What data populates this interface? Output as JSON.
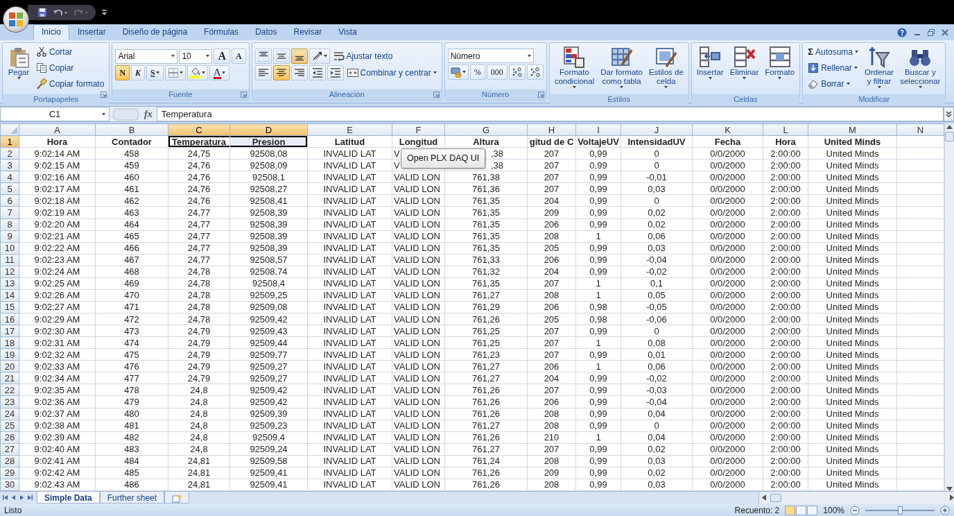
{
  "ribbon_tabs": [
    {
      "label": "Inicio",
      "selected": true
    },
    {
      "label": "Insertar",
      "selected": false
    },
    {
      "label": "Diseño de página",
      "selected": false
    },
    {
      "label": "Fórmulas",
      "selected": false
    },
    {
      "label": "Datos",
      "selected": false
    },
    {
      "label": "Revisar",
      "selected": false
    },
    {
      "label": "Vista",
      "selected": false
    }
  ],
  "groups": [
    {
      "title": "Portapapeles",
      "blocks": [
        {
          "kind": "large",
          "label": "Pegar",
          "dropdown": true
        },
        {
          "kind": "stack",
          "rows": [
            [
              {
                "kind": "small",
                "label": "Cortar"
              }
            ],
            [
              {
                "kind": "small",
                "label": "Copiar"
              }
            ],
            [
              {
                "kind": "small",
                "label": "Copiar formato"
              }
            ]
          ]
        }
      ]
    },
    {
      "title": "Fuente",
      "blocks": [
        {
          "kind": "stack",
          "rows": [
            [
              {
                "kind": "combo",
                "value": "Arial"
              },
              {
                "kind": "combo",
                "value": "10"
              },
              {
                "kind": "text",
                "label": "A"
              },
              {
                "kind": "text",
                "label": "A"
              }
            ],
            [
              {
                "kind": "text",
                "label": "N",
                "selected": true
              },
              {
                "kind": "text",
                "label": "K",
                "selected": false
              },
              {
                "kind": "text",
                "label": "S",
                "selected": false,
                "dropdown": true
              },
              {
                "kind": "icon",
                "dropdown": true
              },
              {
                "kind": "icon",
                "dropdown": true
              },
              {
                "kind": "text",
                "label": "A",
                "dropdown": true
              }
            ]
          ]
        }
      ]
    },
    {
      "title": "Alineación",
      "blocks": [
        {
          "kind": "stack",
          "rows": [
            [
              {
                "kind": "icon",
                "selected": false
              },
              {
                "kind": "icon",
                "selected": false
              },
              {
                "kind": "icon",
                "selected": true
              },
              {
                "kind": "icon",
                "dropdown": true
              },
              {
                "kind": "small",
                "label": "Ajustar texto"
              }
            ],
            [
              {
                "kind": "icon",
                "selected": false
              },
              {
                "kind": "icon",
                "selected": true
              },
              {
                "kind": "icon",
                "selected": false
              },
              {
                "kind": "icon"
              },
              {
                "kind": "icon"
              },
              {
                "kind": "small",
                "label": "Combinar y centrar",
                "dropdown": true
              }
            ]
          ]
        }
      ]
    },
    {
      "title": "Número",
      "blocks": [
        {
          "kind": "stack",
          "rows": [
            [
              {
                "kind": "combo",
                "value": "Número"
              }
            ],
            [
              {
                "kind": "icon",
                "dropdown": true
              },
              {
                "kind": "text",
                "label": "%"
              },
              {
                "kind": "text",
                "label": "000"
              },
              {
                "kind": "icon"
              },
              {
                "kind": "icon"
              }
            ]
          ]
        }
      ]
    },
    {
      "title": "Estilos",
      "blocks": [
        {
          "kind": "large",
          "label": "Formato\ncondicional",
          "dropdown": true
        },
        {
          "kind": "large",
          "label": "Dar formato\ncomo tabla",
          "dropdown": true
        },
        {
          "kind": "large",
          "label": "Estilos de\ncelda",
          "dropdown": true
        }
      ]
    },
    {
      "title": "Celdas",
      "blocks": [
        {
          "kind": "large",
          "label": "Insertar",
          "dropdown": true
        },
        {
          "kind": "large",
          "label": "Eliminar",
          "dropdown": true
        },
        {
          "kind": "large",
          "label": "Formato",
          "dropdown": true
        }
      ]
    },
    {
      "title": "Modificar",
      "blocks": [
        {
          "kind": "stack",
          "rows": [
            [
              {
                "kind": "small",
                "glyph": "Σ",
                "label": "Autosuma",
                "dropdown": true
              }
            ],
            [
              {
                "kind": "small",
                "label": "Rellenar",
                "dropdown": true
              }
            ],
            [
              {
                "kind": "small",
                "label": "Borrar",
                "dropdown": true
              }
            ]
          ]
        },
        {
          "kind": "large",
          "label": "Ordenar\ny filtrar",
          "dropdown": true
        },
        {
          "kind": "large",
          "label": "Buscar y\nseleccionar",
          "dropdown": true
        }
      ]
    }
  ],
  "formula_bar": {
    "name_box": "C1",
    "fx": "fx",
    "content": "Temperatura"
  },
  "columns": [
    {
      "label": "A",
      "selected": false
    },
    {
      "label": "B",
      "selected": false
    },
    {
      "label": "C",
      "selected": true
    },
    {
      "label": "D",
      "selected": true
    },
    {
      "label": "E",
      "selected": false
    },
    {
      "label": "F",
      "selected": false
    },
    {
      "label": "G",
      "selected": false
    },
    {
      "label": "H",
      "selected": false
    },
    {
      "label": "I",
      "selected": false
    },
    {
      "label": "J",
      "selected": false
    },
    {
      "label": "K",
      "selected": false
    },
    {
      "label": "L",
      "selected": false
    },
    {
      "label": "M",
      "selected": false
    },
    {
      "label": "N",
      "selected": false
    }
  ],
  "rows": [
    {
      "label": "1",
      "selected": true,
      "cells": [
        "Hora",
        "Contador",
        "Temperatura",
        "Presion",
        "Latitud",
        "Longitud",
        "Altura",
        "gitud de C",
        "VoltajeUV",
        "IntensidadUV",
        "Fecha",
        "Hora",
        "United Minds"
      ]
    },
    {
      "label": "2",
      "selected": false,
      "cells": [
        "9:02:14 AM",
        "458",
        "24,75",
        "92508,08",
        "INVALID LAT",
        "V",
        {
          "text": ",38",
          "partly_covered": true
        },
        "207",
        "0,99",
        "0",
        "0/0/2000",
        "2:00:00",
        "United Minds"
      ]
    },
    {
      "label": "3",
      "selected": false,
      "cells": [
        "9:02:15 AM",
        "459",
        "24,76",
        "92508,09",
        "INVALID LAT",
        "V",
        {
          "text": ",38",
          "partly_covered": true
        },
        "207",
        "0,99",
        "0",
        "0/0/2000",
        "2:00:00",
        "United Minds"
      ]
    },
    {
      "label": "4",
      "selected": false,
      "cells": [
        "9:02:16 AM",
        "460",
        "24,76",
        "92508,1",
        "INVALID LAT",
        "VALID LON",
        "761,38",
        "207",
        "0,99",
        "-0,01",
        "0/0/2000",
        "2:00:00",
        "United Minds"
      ]
    },
    {
      "label": "5",
      "selected": false,
      "cells": [
        "9:02:17 AM",
        "461",
        "24,76",
        "92508,27",
        "INVALID LAT",
        "VALID LON",
        "761,36",
        "207",
        "0,99",
        "0,03",
        "0/0/2000",
        "2:00:00",
        "United Minds"
      ]
    },
    {
      "label": "6",
      "selected": false,
      "cells": [
        "9:02:18 AM",
        "462",
        "24,76",
        "92508,41",
        "INVALID LAT",
        "VALID LON",
        "761,35",
        "204",
        "0,99",
        "0",
        "0/0/2000",
        "2:00:00",
        "United Minds"
      ]
    },
    {
      "label": "7",
      "selected": false,
      "cells": [
        "9:02:19 AM",
        "463",
        "24,77",
        "92508,39",
        "INVALID LAT",
        "VALID LON",
        "761,35",
        "209",
        "0,99",
        "0,02",
        "0/0/2000",
        "2:00:00",
        "United Minds"
      ]
    },
    {
      "label": "8",
      "selected": false,
      "cells": [
        "9:02:20 AM",
        "464",
        "24,77",
        "92508,39",
        "INVALID LAT",
        "VALID LON",
        "761,35",
        "206",
        "0,99",
        "0,02",
        "0/0/2000",
        "2:00:00",
        "United Minds"
      ]
    },
    {
      "label": "9",
      "selected": false,
      "cells": [
        "9:02:21 AM",
        "465",
        "24,77",
        "92508,39",
        "INVALID LAT",
        "VALID LON",
        "761,35",
        "208",
        "1",
        "0,06",
        "0/0/2000",
        "2:00:00",
        "United Minds"
      ]
    },
    {
      "label": "10",
      "selected": false,
      "cells": [
        "9:02:22 AM",
        "466",
        "24,77",
        "92508,39",
        "INVALID LAT",
        "VALID LON",
        "761,35",
        "205",
        "0,99",
        "0,03",
        "0/0/2000",
        "2:00:00",
        "United Minds"
      ]
    },
    {
      "label": "11",
      "selected": false,
      "cells": [
        "9:02:23 AM",
        "467",
        "24,77",
        "92508,57",
        "INVALID LAT",
        "VALID LON",
        "761,33",
        "206",
        "0,99",
        "-0,04",
        "0/0/2000",
        "2:00:00",
        "United Minds"
      ]
    },
    {
      "label": "12",
      "selected": false,
      "cells": [
        "9:02:24 AM",
        "468",
        "24,78",
        "92508,74",
        "INVALID LAT",
        "VALID LON",
        "761,32",
        "204",
        "0,99",
        "-0,02",
        "0/0/2000",
        "2:00:00",
        "United Minds"
      ]
    },
    {
      "label": "13",
      "selected": false,
      "cells": [
        "9:02:25 AM",
        "469",
        "24,78",
        "92508,4",
        "INVALID LAT",
        "VALID LON",
        "761,35",
        "207",
        "1",
        "0,1",
        "0/0/2000",
        "2:00:00",
        "United Minds"
      ]
    },
    {
      "label": "14",
      "selected": false,
      "cells": [
        "9:02:26 AM",
        "470",
        "24,78",
        "92509,25",
        "INVALID LAT",
        "VALID LON",
        "761,27",
        "208",
        "1",
        "0,05",
        "0/0/2000",
        "2:00:00",
        "United Minds"
      ]
    },
    {
      "label": "15",
      "selected": false,
      "cells": [
        "9:02:27 AM",
        "471",
        "24,78",
        "92509,08",
        "INVALID LAT",
        "VALID LON",
        "761,29",
        "206",
        "0,98",
        "-0,05",
        "0/0/2000",
        "2:00:00",
        "United Minds"
      ]
    },
    {
      "label": "16",
      "selected": false,
      "cells": [
        "9:02:29 AM",
        "472",
        "24,78",
        "92509,42",
        "INVALID LAT",
        "VALID LON",
        "761,26",
        "205",
        "0,98",
        "-0,06",
        "0/0/2000",
        "2:00:00",
        "United Minds"
      ]
    },
    {
      "label": "17",
      "selected": false,
      "cells": [
        "9:02:30 AM",
        "473",
        "24,79",
        "92509,43",
        "INVALID LAT",
        "VALID LON",
        "761,25",
        "207",
        "0,99",
        "0",
        "0/0/2000",
        "2:00:00",
        "United Minds"
      ]
    },
    {
      "label": "18",
      "selected": false,
      "cells": [
        "9:02:31 AM",
        "474",
        "24,79",
        "92509,44",
        "INVALID LAT",
        "VALID LON",
        "761,25",
        "207",
        "1",
        "0,08",
        "0/0/2000",
        "2:00:00",
        "United Minds"
      ]
    },
    {
      "label": "19",
      "selected": false,
      "cells": [
        "9:02:32 AM",
        "475",
        "24,79",
        "92509,77",
        "INVALID LAT",
        "VALID LON",
        "761,23",
        "207",
        "0,99",
        "0,01",
        "0/0/2000",
        "2:00:00",
        "United Minds"
      ]
    },
    {
      "label": "20",
      "selected": false,
      "cells": [
        "9:02:33 AM",
        "476",
        "24,79",
        "92509,27",
        "INVALID LAT",
        "VALID LON",
        "761,27",
        "206",
        "1",
        "0,06",
        "0/0/2000",
        "2:00:00",
        "United Minds"
      ]
    },
    {
      "label": "21",
      "selected": false,
      "cells": [
        "9:02:34 AM",
        "477",
        "24,79",
        "92509,27",
        "INVALID LAT",
        "VALID LON",
        "761,27",
        "204",
        "0,99",
        "-0,02",
        "0/0/2000",
        "2:00:00",
        "United Minds"
      ]
    },
    {
      "label": "22",
      "selected": false,
      "cells": [
        "9:02:35 AM",
        "478",
        "24,8",
        "92509,42",
        "INVALID LAT",
        "VALID LON",
        "761,26",
        "207",
        "0,99",
        "-0,03",
        "0/0/2000",
        "2:00:00",
        "United Minds"
      ]
    },
    {
      "label": "23",
      "selected": false,
      "cells": [
        "9:02:36 AM",
        "479",
        "24,8",
        "92509,42",
        "INVALID LAT",
        "VALID LON",
        "761,26",
        "206",
        "0,99",
        "-0,04",
        "0/0/2000",
        "2:00:00",
        "United Minds"
      ]
    },
    {
      "label": "24",
      "selected": false,
      "cells": [
        "9:02:37 AM",
        "480",
        "24,8",
        "92509,39",
        "INVALID LAT",
        "VALID LON",
        "761,26",
        "208",
        "0,99",
        "0,04",
        "0/0/2000",
        "2:00:00",
        "United Minds"
      ]
    },
    {
      "label": "25",
      "selected": false,
      "cells": [
        "9:02:38 AM",
        "481",
        "24,8",
        "92509,23",
        "INVALID LAT",
        "VALID LON",
        "761,27",
        "208",
        "0,99",
        "0",
        "0/0/2000",
        "2:00:00",
        "United Minds"
      ]
    },
    {
      "label": "26",
      "selected": false,
      "cells": [
        "9:02:39 AM",
        "482",
        "24,8",
        "92509,4",
        "INVALID LAT",
        "VALID LON",
        "761,26",
        "210",
        "1",
        "0,04",
        "0/0/2000",
        "2:00:00",
        "United Minds"
      ]
    },
    {
      "label": "27",
      "selected": false,
      "cells": [
        "9:02:40 AM",
        "483",
        "24,8",
        "92509,24",
        "INVALID LAT",
        "VALID LON",
        "761,27",
        "207",
        "0,99",
        "0,02",
        "0/0/2000",
        "2:00:00",
        "United Minds"
      ]
    },
    {
      "label": "28",
      "selected": false,
      "cells": [
        "9:02:41 AM",
        "484",
        "24,81",
        "92509,58",
        "INVALID LAT",
        "VALID LON",
        "761,24",
        "208",
        "0,99",
        "0,03",
        "0/0/2000",
        "2:00:00",
        "United Minds"
      ]
    },
    {
      "label": "29",
      "selected": false,
      "cells": [
        "9:02:42 AM",
        "485",
        "24,81",
        "92509,41",
        "INVALID LAT",
        "VALID LON",
        "761,26",
        "209",
        "0,99",
        "0,02",
        "0/0/2000",
        "2:00:00",
        "United Minds"
      ]
    },
    {
      "label": "30",
      "selected": false,
      "cells": [
        "9:02:43 AM",
        "486",
        "24,81",
        "92509,41",
        "INVALID LAT",
        "VALID LON",
        "761,26",
        "208",
        "0,99",
        "0,03",
        "0/0/2000",
        "2:00:00",
        "United Minds"
      ]
    }
  ],
  "floating_button": {
    "label": "Open PLX DAQ UI"
  },
  "sheet_tabs": [
    {
      "label": "Simple Data",
      "selected": true
    },
    {
      "label": "Further sheet",
      "selected": false
    }
  ],
  "status_bar": {
    "mode": "Listo",
    "count": "Recuento: 2",
    "views": [
      {
        "selected": true
      },
      {
        "selected": false
      },
      {
        "selected": false
      }
    ],
    "zoom_label": "100%",
    "zoom": {
      "level": 0.5
    }
  }
}
